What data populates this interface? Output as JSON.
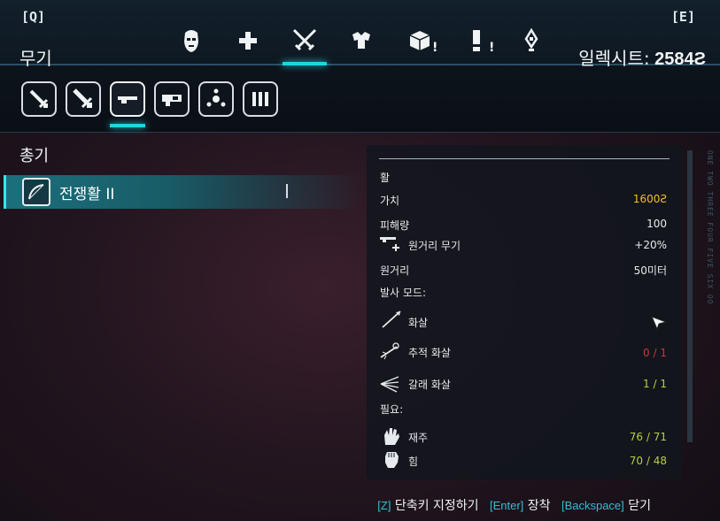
{
  "keys": {
    "prev": "[Q]",
    "next": "[E]"
  },
  "category_tabs": [
    {
      "icon": "mask-icon",
      "active": false
    },
    {
      "icon": "medkit-cross-icon",
      "active": false
    },
    {
      "icon": "crossed-swords-icon",
      "active": true
    },
    {
      "icon": "armor-icon",
      "active": false
    },
    {
      "icon": "box-icon",
      "active": false,
      "alert": "!"
    },
    {
      "icon": "quest-exclamation-icon",
      "active": false,
      "alert": "!"
    },
    {
      "icon": "diamond-marker-icon",
      "active": false
    }
  ],
  "section_title": "무기",
  "currency": {
    "label": "일렉시트:",
    "amount": "2584"
  },
  "sub_tabs": [
    {
      "icon": "sword-icon",
      "active": false
    },
    {
      "icon": "two-hand-sword-icon",
      "active": false
    },
    {
      "icon": "rifle-icon",
      "active": true
    },
    {
      "icon": "heavy-gun-icon",
      "active": false
    },
    {
      "icon": "grenade-icon",
      "active": false
    },
    {
      "icon": "ammo-icon",
      "active": false
    }
  ],
  "list": {
    "title": "총기",
    "items": [
      {
        "name": "전쟁활 II",
        "selected": true
      }
    ]
  },
  "detail": {
    "type": "활",
    "value_label": "가치",
    "value": "1600",
    "damage_label": "피해량",
    "damage": "100",
    "bonus_label": "원거리 무기",
    "bonus": "+20%",
    "range_label": "원거리",
    "range": "50미터",
    "fire_mode_label": "발사 모드:",
    "fire_modes": [
      {
        "label": "화살",
        "value": ""
      },
      {
        "label": "추적 화살",
        "value": "0 / 1"
      },
      {
        "label": "갈래 화살",
        "value": "1 / 1"
      }
    ],
    "req_label": "필요:",
    "requirements": [
      {
        "label": "재주",
        "value": "76 / 71"
      },
      {
        "label": "힘",
        "value": "70 / 48"
      }
    ]
  },
  "side_text": "ONE TWO THREE FOUR FIVE SIX OO",
  "footer": {
    "shortcut_key": "[Z]",
    "shortcut_label": "단축키 지정하기",
    "equip_key": "[Enter]",
    "equip_label": "장착",
    "close_key": "[Backspace]",
    "close_label": "닫기"
  },
  "colors": {
    "accent": "#22d4e0",
    "gold": "#f2c023",
    "ok": "#b7cf3a",
    "bad": "#c23a3a"
  }
}
